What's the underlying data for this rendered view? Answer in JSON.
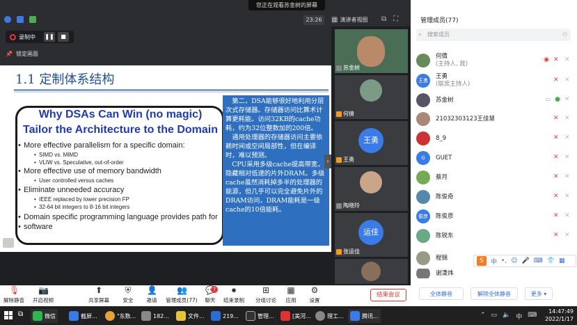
{
  "top": {
    "banner": "您正在观看苏金树的屏幕",
    "time": "23:26",
    "view_label": "演讲者视图"
  },
  "recording": {
    "label": "录制中",
    "lock_label": "锁定画面"
  },
  "slide": {
    "title": "1.1 定制体系结构",
    "heading1": "Why DSAs Can Win (no magic)",
    "heading2": "Tailor the Architecture to the Domain",
    "bullets": [
      "More effective parallelism for a specific domain:",
      "SIMD vs. MIMD",
      "VLIW vs. Speculative, out-of-order",
      "More effective use of memory bandwidth",
      "User controlled versus caches",
      "Eliminate unneeded accuracy",
      "IEEE replaced by lower precision FP",
      "32-64 bit integers to 8-16 bit integers",
      "Domain specific programming language provides path for",
      "software"
    ],
    "callout": [
      "　第二，DSA能够很好地利用分层次式存储器。存储器访问比算术计算更耗能。访问32KB的cache功耗，约为32位整数加的200倍。",
      "　通用处理器的存储器访问主要依赖时间或空间局部性，但在编译时，难以预测。",
      "　CPU采用多级cache提高带宽，隐藏相对低速的片外DRAM。多级cache虽然消耗掉多半的处理器的能源，但几乎可以完全避免片外的DRAM访问，DRAM能耗是一级cache的10倍能耗。"
    ]
  },
  "videos": [
    {
      "name": "苏金树"
    },
    {
      "name": "何倩"
    },
    {
      "name": "王勇",
      "avatar_text": "王勇"
    },
    {
      "name": "陶晓玲"
    },
    {
      "name": "张运佳",
      "avatar_text": "运佳"
    },
    {
      "name": ""
    }
  ],
  "panel": {
    "title": "管理成员(77)",
    "search_placeholder": "搜索成员",
    "members": [
      {
        "name": "何倩",
        "sub": "(主持人, 我)",
        "color": "#6b8a5a"
      },
      {
        "name": "王勇",
        "sub": "(联席主持人)",
        "avatar_text": "王勇",
        "color": "#3b7be8"
      },
      {
        "name": "苏金树",
        "color": "#556"
      },
      {
        "name": "21032303123王佳慧",
        "color": "#a87"
      },
      {
        "name": "8_9",
        "color": "#c33"
      },
      {
        "name": "GUET",
        "avatar_text": "G",
        "color": "#3b7be8"
      },
      {
        "name": "蔡月",
        "color": "#7a5"
      },
      {
        "name": "陈俊奇",
        "color": "#58a"
      },
      {
        "name": "陈俊彦",
        "avatar_text": "俊彦",
        "color": "#3b7be8"
      },
      {
        "name": "陈锐东",
        "color": "#6a8"
      },
      {
        "name": "程锦",
        "color": "#998"
      },
      {
        "name": "谢潇炜",
        "color": "#777"
      }
    ],
    "mute_all": "全体静音",
    "unmute_all": "解除全体静音",
    "more": "更多"
  },
  "toolbar": {
    "items": [
      "解除静音",
      "开启视频",
      "共享屏幕",
      "安全",
      "邀请",
      "管理成员(77)",
      "聊天",
      "结束录制",
      "分组讨论",
      "应用",
      "设置"
    ],
    "chat_badge": "7",
    "end_meeting": "结束会议"
  },
  "taskbar": {
    "items": [
      "微信",
      "截屏...",
      "\"东数...",
      "182...",
      "文件...",
      "219...",
      "管理...",
      "[美河...",
      "理工...",
      "腾讯..."
    ],
    "clock_time": "14:47:49",
    "clock_date": "2022/1/17",
    "ime": "中"
  }
}
